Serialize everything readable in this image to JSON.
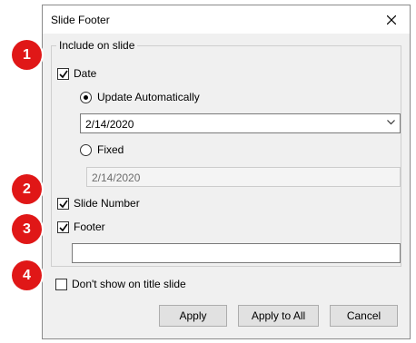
{
  "dialog": {
    "title": "Slide Footer",
    "close_icon": "close-icon"
  },
  "include_group": {
    "label": "Include on slide",
    "date": {
      "label": "Date",
      "checked": true
    },
    "update_automatically": {
      "label": "Update Automatically",
      "selected": true,
      "value": "2/14/2020"
    },
    "fixed": {
      "label": "Fixed",
      "selected": false,
      "value": "2/14/2020"
    },
    "slide_number": {
      "label": "Slide Number",
      "checked": true
    },
    "footer": {
      "label": "Footer",
      "checked": true,
      "value": ""
    }
  },
  "dont_show_title": {
    "label": "Don't show on title slide",
    "checked": false
  },
  "buttons": {
    "apply": "Apply",
    "apply_all": "Apply to All",
    "cancel": "Cancel"
  },
  "callouts": [
    "1",
    "2",
    "3",
    "4"
  ],
  "colors": {
    "callout": "#e01717",
    "dialog_bg": "#f0f0f0"
  }
}
